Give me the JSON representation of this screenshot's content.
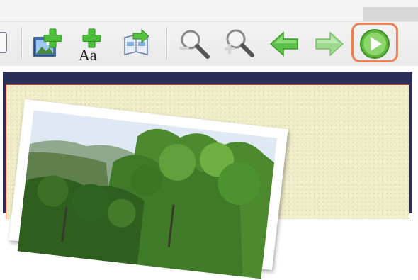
{
  "toolbar": {
    "buttons": [
      {
        "name": "add-image-button",
        "icon": "add-image-icon"
      },
      {
        "name": "add-text-button",
        "icon": "add-text-icon",
        "glyph": "Aa"
      },
      {
        "name": "export-button",
        "icon": "export-icon"
      },
      {
        "name": "zoom-out-button",
        "icon": "zoom-out-icon"
      },
      {
        "name": "zoom-in-button",
        "icon": "zoom-in-icon"
      },
      {
        "name": "previous-button",
        "icon": "arrow-left-icon"
      },
      {
        "name": "next-button",
        "icon": "arrow-right-icon"
      },
      {
        "name": "play-button",
        "icon": "play-icon",
        "highlighted": true
      }
    ]
  },
  "colors": {
    "highlight": "#f07f52",
    "play_green": "#5fb83a",
    "arrow_green": "#5cc24a",
    "paper": "#efecc8",
    "paper_border": "#d23a2a",
    "mat": "#2a2f55"
  }
}
